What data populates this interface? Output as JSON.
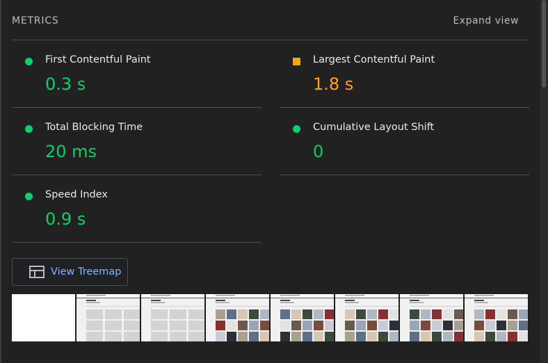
{
  "header": {
    "title": "METRICS",
    "expand_label": "Expand view"
  },
  "metrics": [
    {
      "label": "First Contentful Paint",
      "value": "0.3 s",
      "status": "pass"
    },
    {
      "label": "Largest Contentful Paint",
      "value": "1.8 s",
      "status": "average"
    },
    {
      "label": "Total Blocking Time",
      "value": "20 ms",
      "status": "pass"
    },
    {
      "label": "Cumulative Layout Shift",
      "value": "0",
      "status": "pass"
    },
    {
      "label": "Speed Index",
      "value": "0.9 s",
      "status": "pass"
    }
  ],
  "treemap": {
    "label": "View Treemap",
    "icon": "treemap-icon"
  },
  "filmstrip": {
    "frame_states": [
      "blank",
      "skeleton",
      "skeleton",
      "loaded",
      "loaded",
      "loaded",
      "loaded",
      "loaded"
    ]
  },
  "colors": {
    "pass": "#0cce6b",
    "average": "#ffa400",
    "link": "#8ab4f8",
    "background": "#212121"
  }
}
